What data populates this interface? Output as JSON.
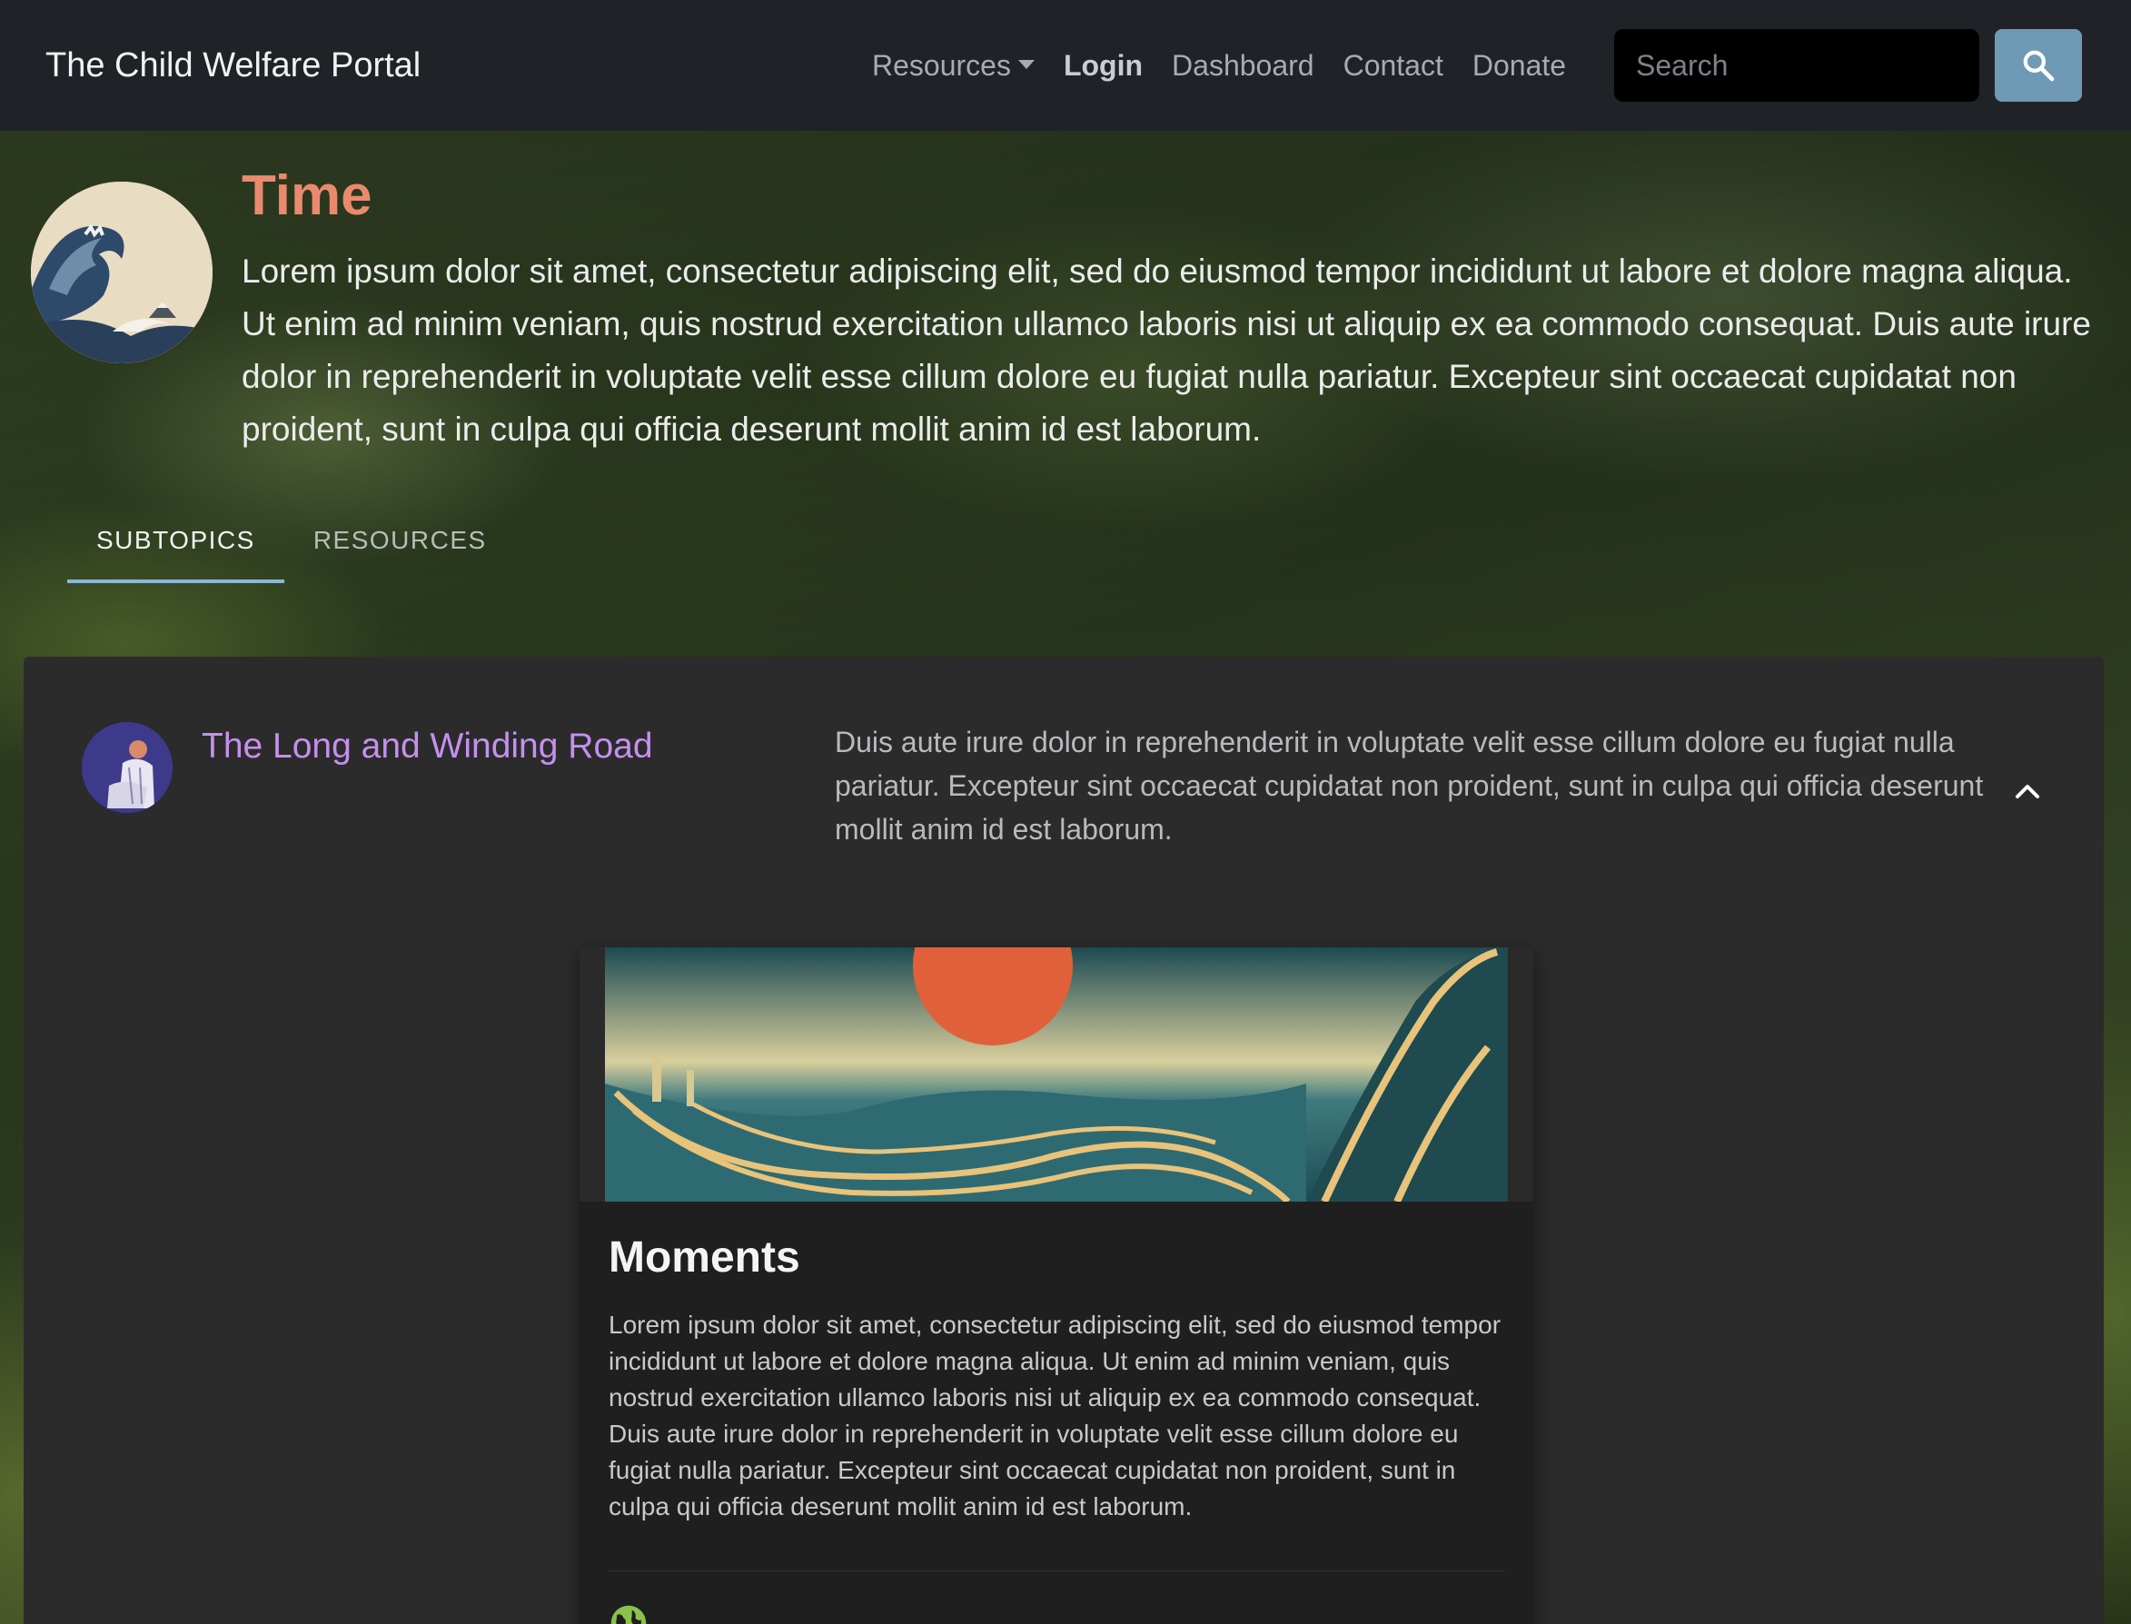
{
  "navbar": {
    "brand": "The Child Welfare Portal",
    "links": {
      "resources": "Resources",
      "login": "Login",
      "dashboard": "Dashboard",
      "contact": "Contact",
      "donate": "Donate"
    },
    "search": {
      "placeholder": "Search",
      "button_icon": "search-icon"
    }
  },
  "topic": {
    "title": "Time",
    "description": "Lorem ipsum dolor sit amet, consectetur adipiscing elit, sed do eiusmod tempor incididunt ut labore et dolore magna aliqua. Ut enim ad minim veniam, quis nostrud exercitation ullamco laboris nisi ut aliquip ex ea commodo consequat. Duis aute irure dolor in reprehenderit in voluptate velit esse cillum dolore eu fugiat nulla pariatur. Excepteur sint occaecat cupidatat non proident, sunt in culpa qui officia deserunt mollit anim id est laborum."
  },
  "tabs": [
    {
      "label": "SUBTOPICS",
      "active": true
    },
    {
      "label": "RESOURCES",
      "active": false
    }
  ],
  "subtopic": {
    "title": "The Long and Winding Road",
    "description": "Duis aute irure dolor in reprehenderit in voluptate velit esse cillum dolore eu fugiat nulla pariatur. Excepteur sint occaecat cupidatat non proident, sunt in culpa qui officia deserunt mollit anim id est laborum.",
    "toggle_icon": "chevron-up-icon"
  },
  "card": {
    "title": "Moments",
    "text": "Lorem ipsum dolor sit amet, consectetur adipiscing elit, sed do eiusmod tempor incididunt ut labore et dolore magna aliqua. Ut enim ad minim veniam, quis nostrud exercitation ullamco laboris nisi ut aliquip ex ea commodo consequat. Duis aute irure dolor in reprehenderit in voluptate velit esse cillum dolore eu fugiat nulla pariatur. Excepteur sint occaecat cupidatat non proident, sunt in culpa qui officia deserunt mollit anim id est laborum.",
    "link_icon": "globe-icon"
  },
  "colors": {
    "topic_title": "#e98a6e",
    "subtopic_title": "#c690ee",
    "tab_indicator": "#8db7d9",
    "search_button": "#6f9ab6",
    "globe": "#8bc34a"
  }
}
